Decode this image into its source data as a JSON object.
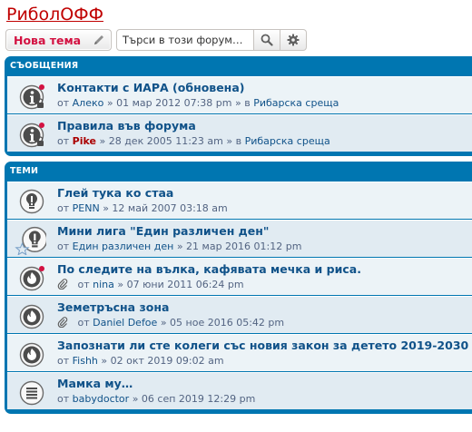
{
  "forum": {
    "title": "РиболОФФ"
  },
  "toolbar": {
    "new_topic_label": "Нова тема",
    "search_placeholder": "Търси в този форум…"
  },
  "announcements": {
    "header": "Съобщения",
    "rows": [
      {
        "title": "Контакти с ИАРА (обновена)",
        "by": "от",
        "author": "Алеко",
        "sep": "»",
        "date": "01 мар 2012 07:38 pm",
        "in": "» в",
        "forum": "Рибарска среща"
      },
      {
        "title": "Правила във форума",
        "by": "от",
        "author": "Pike",
        "sep": "»",
        "date": "28 дек 2005 11:23 am",
        "in": "» в",
        "forum": "Рибарска среща"
      }
    ]
  },
  "topics": {
    "header": "Теми",
    "rows": [
      {
        "title": "Глей тука ко стаа",
        "by": "от",
        "author": "PENN",
        "sep": "»",
        "date": "12 май 2007 03:18 am"
      },
      {
        "title": "Мини лига \"Един различен ден\"",
        "by": "от",
        "author": "Един различен ден",
        "sep": "»",
        "date": "21 мар 2016 01:12 pm"
      },
      {
        "title": "По следите на вълка, кафявата мечка и риса.",
        "by": "от",
        "author": "nina",
        "sep": "»",
        "date": "07 юни 2011 06:24 pm"
      },
      {
        "title": "Земетръсна зона",
        "by": "от",
        "author": "Daniel Defoe",
        "sep": "»",
        "date": "05 ное 2016 05:42 pm"
      },
      {
        "title": "Запознати ли сте колеги със новия закон за детето 2019-2030",
        "by": "от",
        "author": "Fishh",
        "sep": "»",
        "date": "02 окт 2019 09:02 am"
      },
      {
        "title": "Мамка му…",
        "by": "от",
        "author": "babydoctor",
        "sep": "»",
        "date": "06 сеп 2019 12:29 pm"
      }
    ]
  },
  "colors": {
    "header_blue": "#0076b1",
    "title_red": "#c00000",
    "link_blue": "#105289",
    "new_marker_red": "#d31141"
  }
}
